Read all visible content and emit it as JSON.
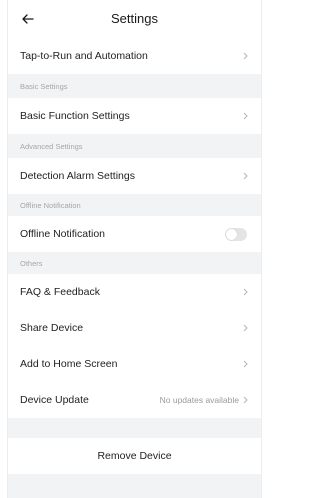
{
  "header": {
    "title": "Settings",
    "back_icon": "back-arrow-icon"
  },
  "rows_top": {
    "tap_to_run": "Tap-to-Run and Automation"
  },
  "sections": {
    "basic": "Basic Settings",
    "advanced": "Advanced Settings",
    "offline": "Offline Notification",
    "others": "Others"
  },
  "basic": {
    "function_settings": "Basic Function Settings"
  },
  "advanced": {
    "detection_alarm": "Detection Alarm Settings"
  },
  "offline": {
    "label": "Offline Notification",
    "enabled": false
  },
  "others": {
    "faq": "FAQ & Feedback",
    "share": "Share Device",
    "add_home": "Add to Home Screen",
    "update_label": "Device Update",
    "update_status": "No updates available"
  },
  "footer": {
    "remove": "Remove Device"
  },
  "colors": {
    "background": "#f2f3f5",
    "card": "#ffffff",
    "toggle_off": "#e4e4e6",
    "muted_text": "#a6a6a6"
  }
}
